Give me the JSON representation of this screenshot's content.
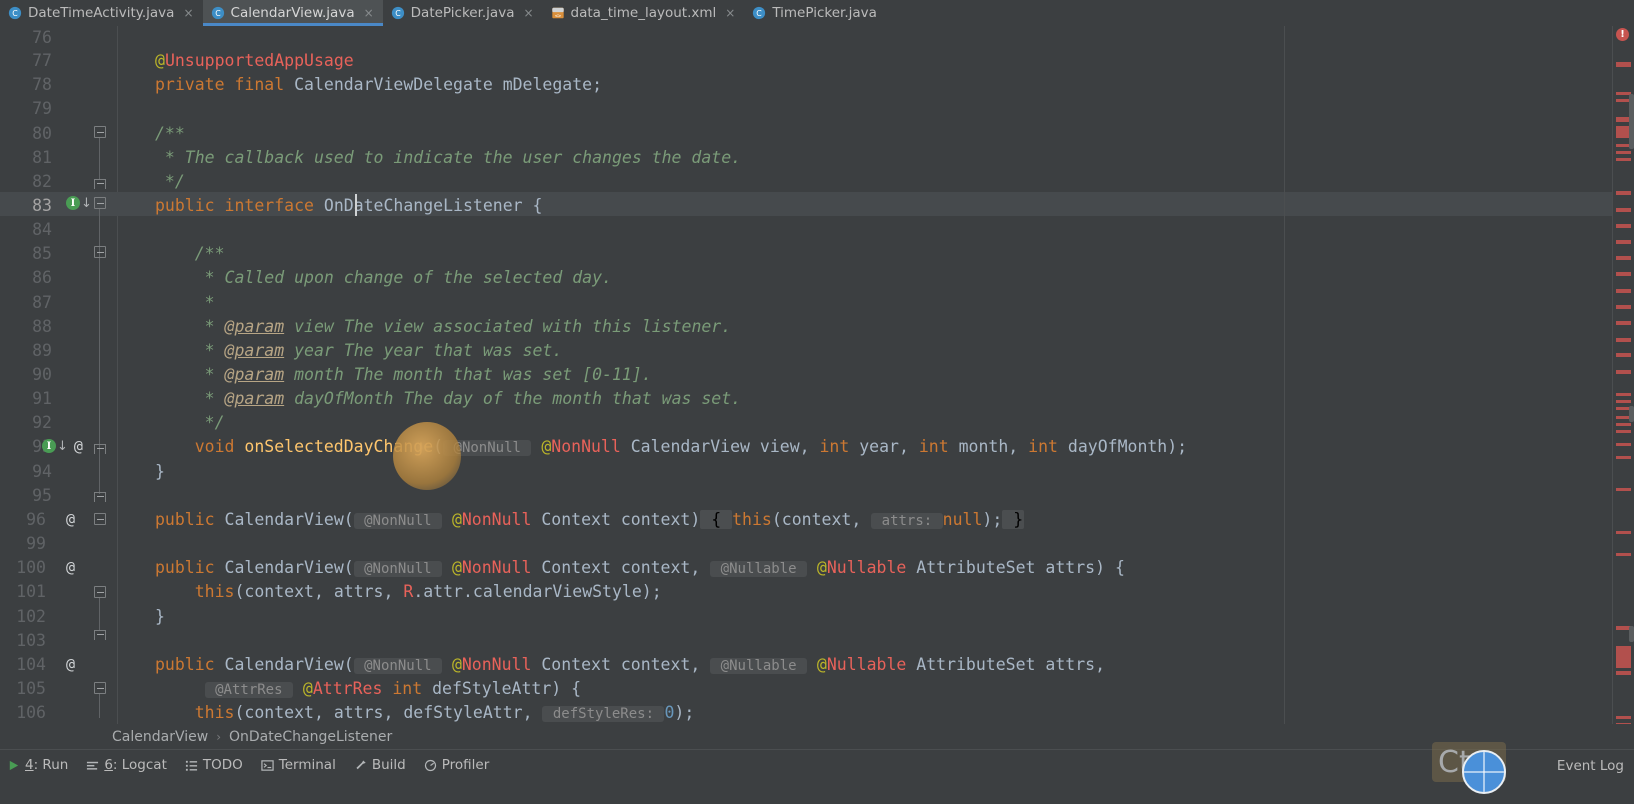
{
  "window": {
    "app": "IntelliJ IDEA / Android Studio",
    "theme_background": "#3c3f41",
    "editor_background": "#3c3f41",
    "accent": "#4a88c7"
  },
  "tabs": [
    {
      "label": "DateTimeActivity.java",
      "icon": "java-class-icon",
      "active": false,
      "close": "×"
    },
    {
      "label": "CalendarView.java",
      "icon": "java-class-icon",
      "active": true,
      "close": "×"
    },
    {
      "label": "DatePicker.java",
      "icon": "java-class-icon",
      "active": false,
      "close": "×"
    },
    {
      "label": "data_time_layout.xml",
      "icon": "android-xml-icon",
      "active": false,
      "close": "×"
    },
    {
      "label": "TimePicker.java",
      "icon": "java-class-icon",
      "active": false,
      "close": ""
    }
  ],
  "editor": {
    "language": "java",
    "caret_line": 83,
    "caret_column_text": "public interface |OnDateChangeListener {",
    "first_visible_line": 76,
    "last_visible_line": 106,
    "lines": [
      {
        "n": "76",
        "indent": 0,
        "text": ""
      },
      {
        "n": "77",
        "indent": 0,
        "text": "    @UnsupportedAppUsage"
      },
      {
        "n": "78",
        "indent": 0,
        "text": "    private final CalendarViewDelegate mDelegate;"
      },
      {
        "n": "79",
        "indent": 0,
        "text": ""
      },
      {
        "n": "80",
        "indent": 0,
        "text": "    /**"
      },
      {
        "n": "81",
        "indent": 0,
        "text": "     * The callback used to indicate the user changes the date."
      },
      {
        "n": "82",
        "indent": 0,
        "text": "     */"
      },
      {
        "n": "83",
        "indent": 0,
        "text": "    public interface OnDateChangeListener {"
      },
      {
        "n": "84",
        "indent": 0,
        "text": ""
      },
      {
        "n": "85",
        "indent": 0,
        "text": "        /**"
      },
      {
        "n": "86",
        "indent": 0,
        "text": "         * Called upon change of the selected day."
      },
      {
        "n": "87",
        "indent": 0,
        "text": "         *"
      },
      {
        "n": "88",
        "indent": 0,
        "text": "         * @param view The view associated with this listener."
      },
      {
        "n": "89",
        "indent": 0,
        "text": "         * @param year The year that was set."
      },
      {
        "n": "90",
        "indent": 0,
        "text": "         * @param month The month that was set [0-11]."
      },
      {
        "n": "91",
        "indent": 0,
        "text": "         * @param dayOfMonth The day of the month that was set."
      },
      {
        "n": "92",
        "indent": 0,
        "text": "         */"
      },
      {
        "n": "93",
        "indent": 0,
        "text": "        void onSelectedDayChange( @NonNull @NonNull CalendarView view, int year, int month, int dayOfMonth);"
      },
      {
        "n": "94",
        "indent": 0,
        "text": "    }"
      },
      {
        "n": "95",
        "indent": 0,
        "text": ""
      },
      {
        "n": "96",
        "indent": 0,
        "text": "    public CalendarView( @NonNull @NonNull Context context) { this(context,  attrs: null); }"
      },
      {
        "n": "99",
        "indent": 0,
        "text": ""
      },
      {
        "n": "100",
        "indent": 0,
        "text": "    public CalendarView( @NonNull @NonNull Context context,  @Nullable @Nullable AttributeSet attrs) {"
      },
      {
        "n": "101",
        "indent": 0,
        "text": "        this(context, attrs, R.attr.calendarViewStyle);"
      },
      {
        "n": "102",
        "indent": 0,
        "text": "    }"
      },
      {
        "n": "103",
        "indent": 0,
        "text": ""
      },
      {
        "n": "104",
        "indent": 0,
        "text": "    public CalendarView( @NonNull @NonNull Context context,  @Nullable @Nullable AttributeSet attrs,"
      },
      {
        "n": "105",
        "indent": 0,
        "text": "            @AttrRes @AttrRes int defStyleAttr) {"
      },
      {
        "n": "106",
        "indent": 0,
        "text": "        this(context, attrs, defStyleAttr,  defStyleRes: 0);"
      }
    ],
    "inlay_hints": [
      "@NonNull",
      "@Nullable",
      "@AttrRes",
      "attrs:",
      "defStyleRes:"
    ],
    "gutter_markers": [
      {
        "line": "83",
        "icon": "implemented-interface-icon",
        "glyph": "I"
      },
      {
        "line": "93",
        "icon": "implemented-method-icon",
        "glyph": "I"
      },
      {
        "line": "93",
        "icon": "override-annotation-icon",
        "glyph": "@"
      },
      {
        "line": "96",
        "icon": "override-annotation-icon",
        "glyph": "@"
      },
      {
        "line": "100",
        "icon": "override-annotation-icon",
        "glyph": "@"
      },
      {
        "line": "104",
        "icon": "override-annotation-icon",
        "glyph": "@"
      }
    ]
  },
  "error_stripe": {
    "warning_icon": "error-marker-icon",
    "warning_glyph": "!",
    "marker_color": "#c75450"
  },
  "breadcrumb": {
    "items": [
      "CalendarView",
      "OnDateChangeListener"
    ],
    "separator": "›"
  },
  "statusbar": {
    "items": [
      {
        "num": "4",
        "label": ": Run",
        "icon": "run-icon"
      },
      {
        "num": "6",
        "label": ": Logcat",
        "icon": "logcat-icon"
      },
      {
        "num": "",
        "label": "TODO",
        "icon": "todo-icon"
      },
      {
        "num": "",
        "label": "Terminal",
        "icon": "terminal-icon"
      },
      {
        "num": "",
        "label": "Build",
        "icon": "build-hammer-icon"
      },
      {
        "num": "",
        "label": "Profiler",
        "icon": "profiler-icon"
      }
    ],
    "event_log": "Event Log"
  },
  "overlay": {
    "ctrl_hint_text": "Ct",
    "globe_icon": "globe-icon",
    "cursor_icon": "mouse-cursor-highlight"
  }
}
